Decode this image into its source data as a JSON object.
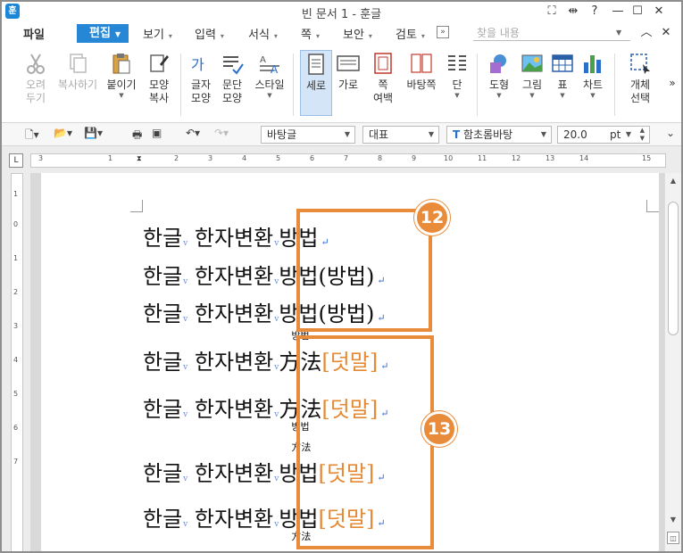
{
  "window": {
    "title": "빈 문서 1 - 훈글",
    "logo": "훈"
  },
  "menu": {
    "file": "파일",
    "active": "편집",
    "items": [
      "보기",
      "입력",
      "서식",
      "쪽",
      "보안",
      "검토"
    ],
    "more": "»",
    "search_placeholder": "찾을 내용"
  },
  "ribbon": {
    "cut": "오려\n두기",
    "copy": "복사하기",
    "paste": "붙이기",
    "format_copy": "모양\n복사",
    "char_shape": "글자\n모양",
    "para_shape": "문단\n모양",
    "style": "스타일",
    "portrait": "세로",
    "landscape": "가로",
    "margin": "쪽\n여백",
    "facing": "바탕쪽",
    "column": "단",
    "shape": "도형",
    "picture": "그림",
    "table": "표",
    "chart": "차트",
    "object": "개체\n선택",
    "expand": "»"
  },
  "toolbar": {
    "style": "바탕글",
    "para_style": "대표",
    "font": "함초롬바탕",
    "size": "20.0",
    "unit": "pt"
  },
  "ruler": {
    "marks": [
      "3",
      "1",
      "2",
      "3",
      "4",
      "5",
      "6",
      "7",
      "8",
      "9",
      "10",
      "11",
      "12",
      "13",
      "14",
      "15"
    ],
    "vmarks": [
      "1",
      "0",
      "1",
      "2",
      "3",
      "4",
      "5",
      "6",
      "7"
    ]
  },
  "document": {
    "prefix1": "한글",
    "prefix2": "한자변환",
    "lines": [
      {
        "main": "방법",
        "suffix": ""
      },
      {
        "main": "방법(방법)",
        "suffix": ""
      },
      {
        "main": "방법(방법)",
        "suffix": ""
      },
      {
        "main": "方法",
        "suffix": "[덧말]",
        "ruby_top": "방법"
      },
      {
        "main": "方法",
        "suffix": "[덧말]",
        "ruby_bot": "방법"
      },
      {
        "main": "방법",
        "suffix": "[덧말]",
        "ruby_top": "方法"
      },
      {
        "main": "방법",
        "suffix": "[덧말]",
        "ruby_bot": "方法"
      }
    ],
    "badge1": "12",
    "badge2": "13"
  },
  "colors": {
    "accent": "#2787d7",
    "highlight": "#e88b3a"
  }
}
